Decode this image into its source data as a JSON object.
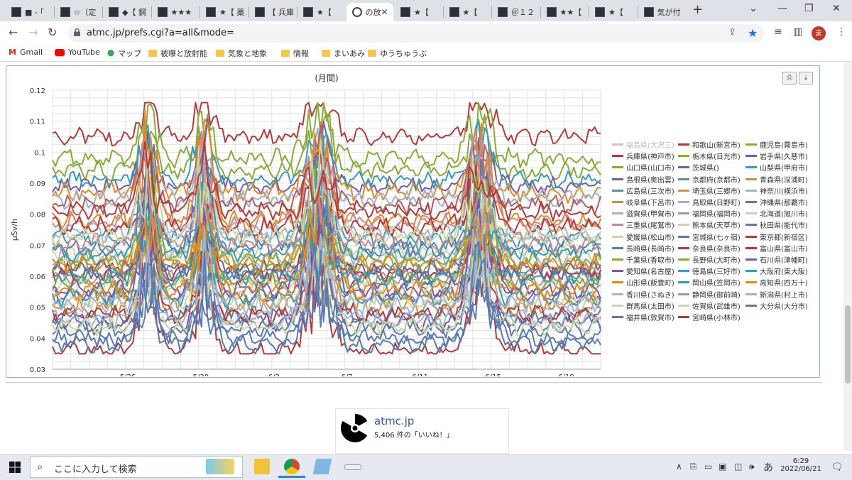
{
  "browser": {
    "tabs": [
      {
        "label": "■ - ｢",
        "active": false
      },
      {
        "label": "☆（定",
        "active": false
      },
      {
        "label": "◆【 鋼",
        "active": false
      },
      {
        "label": "★★★",
        "active": false
      },
      {
        "label": "★【 藁",
        "active": false
      },
      {
        "label": "【 兵庫",
        "active": false
      },
      {
        "label": "★【 ",
        "active": false
      },
      {
        "label": "の放",
        "active": true
      },
      {
        "label": "★【 ",
        "active": false
      },
      {
        "label": "★【 ",
        "active": false
      },
      {
        "label": "＠１２",
        "active": false
      },
      {
        "label": "★★【",
        "active": false
      },
      {
        "label": "★【 ",
        "active": false
      },
      {
        "label": "気が付",
        "active": false
      }
    ],
    "new_tab": "+",
    "url": "atmc.jp/prefs.cgi?a=all&mode=",
    "profile_initial": "ま",
    "bookmarks": [
      {
        "label": "Gmail",
        "icon": "gmail-icon"
      },
      {
        "label": "YouTube",
        "icon": "youtube-icon"
      },
      {
        "label": "マップ",
        "icon": "maps-icon"
      },
      {
        "label": "被曝と放射能",
        "icon": "folder-icon"
      },
      {
        "label": "気象と地象",
        "icon": "folder-icon"
      },
      {
        "label": "情報",
        "icon": "folder-icon"
      },
      {
        "label": "まいあみ",
        "icon": "folder-icon"
      },
      {
        "label": "ゆうちゅうぶ",
        "icon": "folder-icon"
      }
    ]
  },
  "chart_data": {
    "type": "line",
    "title": "(月間)",
    "ylabel": "μSv/h",
    "xlabel": "",
    "ylim": [
      0.03,
      0.12
    ],
    "yticks": [
      "0.03",
      "0.04",
      "0.05",
      "0.06",
      "0.07",
      "0.08",
      "0.09",
      "0.1",
      "0.11",
      "0.12"
    ],
    "xticks": [
      "5/26",
      "5/30",
      "6/3",
      "6/7",
      "6/11",
      "6/15",
      "6/19"
    ],
    "x_range_days": [
      "5/22",
      "6/21"
    ],
    "grid": true,
    "legend_position": "right",
    "series": [
      {
        "name": "福島県(大沢三)",
        "color": "#c6c6c6",
        "base": 0.0,
        "hidden": true
      },
      {
        "name": "和歌山(新宮市)",
        "color": "#b33b3b",
        "base": 0.105
      },
      {
        "name": "鹿児島(霧島市)",
        "color": "#8aaa3a",
        "base": 0.094
      },
      {
        "name": "兵庫県(神戸市)",
        "color": "#b33b3b",
        "base": 0.036
      },
      {
        "name": "栃木県(日光市)",
        "color": "#8aaa3a",
        "base": 0.098
      },
      {
        "name": "岩手県(久慈市)",
        "color": "#7d5aa0",
        "base": 0.089
      },
      {
        "name": "山口県(山口市)",
        "color": "#8aaa3a",
        "base": 0.063
      },
      {
        "name": "茨城県()",
        "color": "#7d5aa0",
        "base": 0.045
      },
      {
        "name": "山梨県(甲府市)",
        "color": "#3a9ab8",
        "base": 0.091
      },
      {
        "name": "島根県(奥出雲)",
        "color": "#7d5aa0",
        "base": 0.054
      },
      {
        "name": "京都府(京都市)",
        "color": "#3a9ab8",
        "base": 0.061
      },
      {
        "name": "青森県(深浦町)",
        "color": "#e08a2a",
        "base": 0.087
      },
      {
        "name": "広島県(三次市)",
        "color": "#3a9ab8",
        "base": 0.072
      },
      {
        "name": "埼玉県(三郷市)",
        "color": "#e08a2a",
        "base": 0.05
      },
      {
        "name": "神奈川(横浜市)",
        "color": "#a0b4d0",
        "base": 0.085
      },
      {
        "name": "岐阜県(下呂市)",
        "color": "#e08a2a",
        "base": 0.078
      },
      {
        "name": "鳥取県(日野町)",
        "color": "#a0b4d0",
        "base": 0.074
      },
      {
        "name": "沖縄県(那覇市)",
        "color": "#b06060",
        "base": 0.083
      },
      {
        "name": "滋賀県(甲賀市)",
        "color": "#a0b4d0",
        "base": 0.066
      },
      {
        "name": "福岡県(福岡市)",
        "color": "#c88a8a",
        "base": 0.059
      },
      {
        "name": "北海道(旭川市)",
        "color": "#c8d8a0",
        "base": 0.052
      },
      {
        "name": "三重県(尾鷲市)",
        "color": "#c88a8a",
        "base": 0.077
      },
      {
        "name": "熊本県(天草市)",
        "color": "#c8d8a0",
        "base": 0.067
      },
      {
        "name": "秋田県(能代市)",
        "color": "#5a7ab0",
        "base": 0.047
      },
      {
        "name": "愛媛県(松山市)",
        "color": "#c8d8a0",
        "base": 0.057
      },
      {
        "name": "宮城県(七ヶ宿)",
        "color": "#5a7ab0",
        "base": 0.043
      },
      {
        "name": "東京都(新宿区)",
        "color": "#b33b3b",
        "base": 0.076
      },
      {
        "name": "長崎県(長崎市)",
        "color": "#5a7ab0",
        "base": 0.069
      },
      {
        "name": "奈良県(奈良市)",
        "color": "#b33b3b",
        "base": 0.048
      },
      {
        "name": "富山県(富山市)",
        "color": "#b33b3b",
        "base": 0.061
      },
      {
        "name": "千葉県(香取市)",
        "color": "#8aaa3a",
        "base": 0.065
      },
      {
        "name": "長野県(大町市)",
        "color": "#8aaa3a",
        "base": 0.058
      },
      {
        "name": "石川県(津幡町)",
        "color": "#7d5aa0",
        "base": 0.062
      },
      {
        "name": "愛知県(名古屋)",
        "color": "#7d5aa0",
        "base": 0.056
      },
      {
        "name": "徳島県(三好市)",
        "color": "#3a9ab8",
        "base": 0.053
      },
      {
        "name": "大阪府(東大阪)",
        "color": "#3a9ab8",
        "base": 0.06
      },
      {
        "name": "山形県(飯豊町)",
        "color": "#e08a2a",
        "base": 0.055
      },
      {
        "name": "岡山県(笠岡市)",
        "color": "#3a9ab8",
        "base": 0.068
      },
      {
        "name": "高知県(四万十)",
        "color": "#e08a2a",
        "base": 0.064
      },
      {
        "name": "香川県(さぬき)",
        "color": "#a0b4d0",
        "base": 0.046
      },
      {
        "name": "静岡県(御前崎)",
        "color": "#c88a8a",
        "base": 0.071
      },
      {
        "name": "新潟県(村上市)",
        "color": "#a0b4d0",
        "base": 0.051
      },
      {
        "name": "群馬県(太田市)",
        "color": "#c8d8a0",
        "base": 0.073
      },
      {
        "name": "佐賀県(武雄市)",
        "color": "#c8d8a0",
        "base": 0.044
      },
      {
        "name": "大分県(大分市)",
        "color": "#5a7ab0",
        "base": 0.04
      },
      {
        "name": "福井県(敦賀市)",
        "color": "#5a7ab0",
        "base": 0.038
      },
      {
        "name": "宮崎県(小林市)",
        "color": "#b33b3b",
        "base": 0.081
      }
    ]
  },
  "facebook": {
    "name": "atmc.jp",
    "likes": "5,406 件の「いいね！」"
  },
  "taskbar": {
    "search_placeholder": "ここに入力して検索",
    "time": "6:29",
    "date": "2022/06/21",
    "ime": "あ"
  }
}
